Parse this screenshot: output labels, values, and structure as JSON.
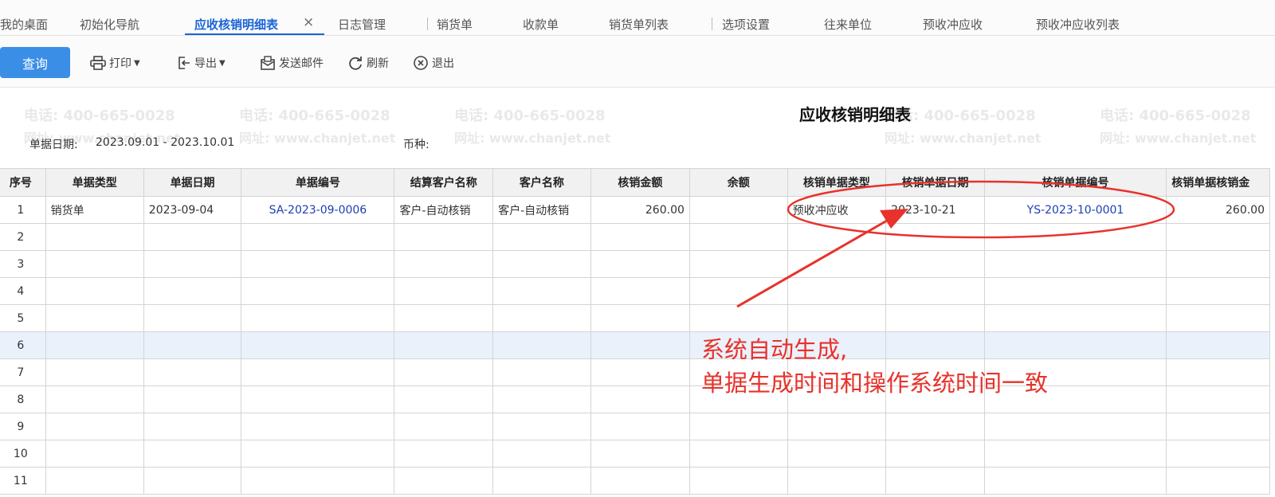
{
  "tabs": [
    {
      "label": "我的桌面"
    },
    {
      "label": "初始化导航"
    },
    {
      "label": "应收核销明细表"
    },
    {
      "label": "日志管理"
    },
    {
      "label": "销货单"
    },
    {
      "label": "收款单"
    },
    {
      "label": "销货单列表"
    },
    {
      "label": "选项设置"
    },
    {
      "label": "往来单位"
    },
    {
      "label": "预收冲应收"
    },
    {
      "label": "预收冲应收列表"
    }
  ],
  "active_tab_close": "×",
  "toolbar": {
    "query": "查询",
    "print": "打印",
    "export": "导出",
    "send_mail": "发送邮件",
    "refresh": "刷新",
    "exit": "退出"
  },
  "report": {
    "title": "应收核销明细表",
    "date_label": "单据日期:",
    "date_value": "2023.09.01 - 2023.10.01",
    "currency_label": "币种:"
  },
  "table": {
    "headers": [
      "序号",
      "单据类型",
      "单据日期",
      "单据编号",
      "结算客户名称",
      "客户名称",
      "核销金额",
      "余额",
      "核销单据类型",
      "核销单据日期",
      "核销单据编号",
      "核销单据核销金"
    ],
    "rows": [
      {
        "idx": "1",
        "doc_type": "销货单",
        "doc_date": "2023-09-04",
        "doc_no": "SA-2023-09-0006",
        "settle_customer": "客户-自动核销",
        "customer": "客户-自动核销",
        "amount": "260.00",
        "balance": "",
        "vtype": "预收冲应收",
        "vdate": "2023-10-21",
        "vno": "YS-2023-10-0001",
        "vamount": "260.00"
      },
      {
        "idx": "2"
      },
      {
        "idx": "3"
      },
      {
        "idx": "4"
      },
      {
        "idx": "5"
      },
      {
        "idx": "6"
      },
      {
        "idx": "7"
      },
      {
        "idx": "8"
      },
      {
        "idx": "9"
      },
      {
        "idx": "10"
      },
      {
        "idx": "11"
      }
    ]
  },
  "annotation": {
    "line1": "系统自动生成,",
    "line2": "单据生成时间和操作系统时间一致",
    "color": "#e8322b"
  },
  "watermark": {
    "phone": "电话: 400-665-0028",
    "url": "网址: www.chanjet.net"
  },
  "colors": {
    "accent": "#3a8ee6",
    "active_tab": "#1a63d6",
    "link": "#1b3fb5",
    "highlight_row": "#eaf1fb"
  }
}
